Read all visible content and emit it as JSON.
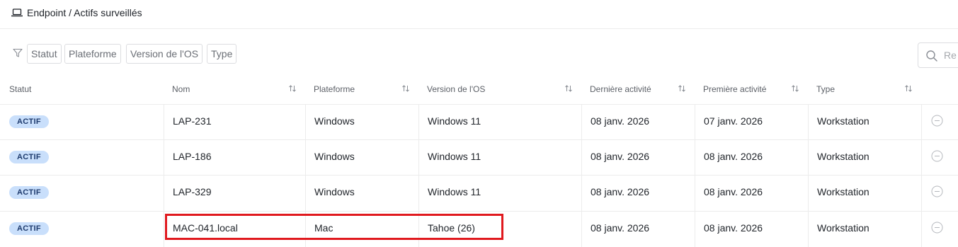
{
  "breadcrumb": {
    "icon": "laptop-icon",
    "text": "Endpoint / Actifs surveillés"
  },
  "filters": {
    "icon": "filter-icon",
    "chips": [
      "Statut",
      "Plateforme",
      "Version de l'OS",
      "Type"
    ]
  },
  "search": {
    "icon": "search-icon",
    "placeholder": "Re"
  },
  "columns": [
    "Statut",
    "Nom",
    "Plateforme",
    "Version de l'OS",
    "Dernière activité",
    "Première activité",
    "Type"
  ],
  "rows": [
    {
      "status": "ACTIF",
      "name": "LAP-231",
      "platform": "Windows",
      "os": "Windows 11",
      "last": "08 janv. 2026",
      "first": "07 janv. 2026",
      "type": "Workstation"
    },
    {
      "status": "ACTIF",
      "name": "LAP-186",
      "platform": "Windows",
      "os": "Windows 11",
      "last": "08 janv. 2026",
      "first": "08 janv. 2026",
      "type": "Workstation"
    },
    {
      "status": "ACTIF",
      "name": "LAP-329",
      "platform": "Windows",
      "os": "Windows 11",
      "last": "08 janv. 2026",
      "first": "08 janv. 2026",
      "type": "Workstation"
    },
    {
      "status": "ACTIF",
      "name": "MAC-041.local",
      "platform": "Mac",
      "os": "Tahoe (26)",
      "last": "08 janv. 2026",
      "first": "08 janv. 2026",
      "type": "Workstation"
    }
  ],
  "colors": {
    "badge_bg": "#c9dffb",
    "badge_text": "#1e3b6e",
    "highlight": "#e0191e"
  }
}
